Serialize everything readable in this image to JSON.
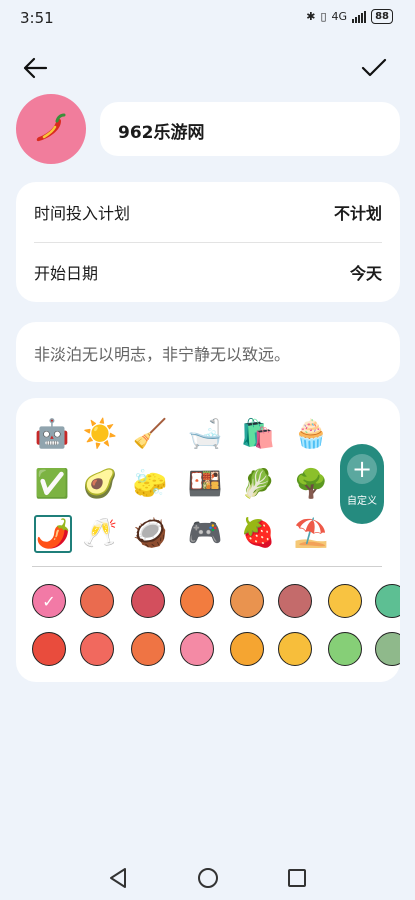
{
  "status_bar": {
    "time": "3:51",
    "network": "4G",
    "battery": "88"
  },
  "task": {
    "name": "962乐游网",
    "avatar_icon": "chili-pepper-icon",
    "avatar_color": "#f17d9c"
  },
  "plan": {
    "rows": [
      {
        "label": "时间投入计划",
        "value": "不计划"
      },
      {
        "label": "开始日期",
        "value": "今天"
      }
    ]
  },
  "motto": "非淡泊无以明志，非宁静无以致远。",
  "icons": {
    "items": [
      {
        "name": "robot-icon",
        "glyph": "🤖"
      },
      {
        "name": "sun-icon",
        "glyph": "☀️"
      },
      {
        "name": "cleaning-icon",
        "glyph": "🧹"
      },
      {
        "name": "bathtub-icon",
        "glyph": "🛁"
      },
      {
        "name": "shopping-bag-icon",
        "glyph": "🛍️"
      },
      {
        "name": "cupcake-icon",
        "glyph": "🧁"
      },
      {
        "name": "check-badge-icon",
        "glyph": "✅"
      },
      {
        "name": "avocado-icon",
        "glyph": "🥑"
      },
      {
        "name": "vacuum-icon",
        "glyph": "🧽"
      },
      {
        "name": "sushi-icon",
        "glyph": "🍱"
      },
      {
        "name": "spinach-leaf-icon",
        "glyph": "🥬"
      },
      {
        "name": "park-icon",
        "glyph": "🌳"
      },
      {
        "name": "chili-pepper-icon",
        "glyph": "🌶️",
        "selected": true
      },
      {
        "name": "cheers-icon",
        "glyph": "🥂"
      },
      {
        "name": "coconut-drink-icon",
        "glyph": "🥥"
      },
      {
        "name": "game-controller-icon",
        "glyph": "🎮"
      },
      {
        "name": "strawberry-icon",
        "glyph": "🍓"
      },
      {
        "name": "beach-umbrella-icon",
        "glyph": "⛱️"
      }
    ],
    "custom_label": "自定义"
  },
  "colors": {
    "row1": [
      "#f27aa6",
      "#ea6b4f",
      "#d34f5d",
      "#f27c3f",
      "#e9934f",
      "#c46b6b",
      "#f8c341",
      "#5dbf93"
    ],
    "row2": [
      "#e94c3d",
      "#f1695e",
      "#ef7444",
      "#f48aa5",
      "#f5a531",
      "#f7be3b",
      "#86cf77",
      "#8fb98b"
    ],
    "selected": "#f27aa6"
  },
  "accent_color": "#258b7f"
}
